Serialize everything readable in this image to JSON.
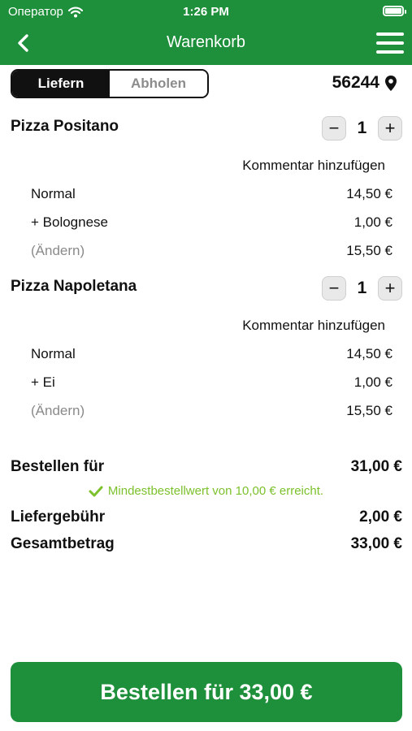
{
  "status_bar": {
    "carrier": "Оператор",
    "time": "1:26 PM"
  },
  "header": {
    "title": "Warenkorb"
  },
  "mode_toggle": {
    "deliver_label": "Liefern",
    "pickup_label": "Abholen"
  },
  "location": {
    "zip": "56244"
  },
  "cart": {
    "items": [
      {
        "name": "Pizza Positano",
        "quantity": "1",
        "comment_label": "Kommentar hinzufügen",
        "size_label": "Normal",
        "size_price": "14,50 €",
        "extra_label": "+ Bolognese",
        "extra_price": "1,00 €",
        "change_label": "(Ändern)",
        "item_total": "15,50 €"
      },
      {
        "name": "Pizza Napoletana",
        "quantity": "1",
        "comment_label": "Kommentar hinzufügen",
        "size_label": "Normal",
        "size_price": "14,50 €",
        "extra_label": "+ Ei",
        "extra_price": "1,00 €",
        "change_label": "(Ändern)",
        "item_total": "15,50 €"
      }
    ]
  },
  "summary": {
    "subtotal_label": "Bestellen für",
    "subtotal_value": "31,00 €",
    "minimum_note": "Mindestbestellwert von 10,00 € erreicht.",
    "delivery_fee_label": "Liefergebühr",
    "delivery_fee_value": "2,00 €",
    "total_label": "Gesamtbetrag",
    "total_value": "33,00 €"
  },
  "order_button": {
    "label": "Bestellen für 33,00 €"
  },
  "colors": {
    "brand": "#1e8f3a",
    "success": "#7cc12c"
  }
}
